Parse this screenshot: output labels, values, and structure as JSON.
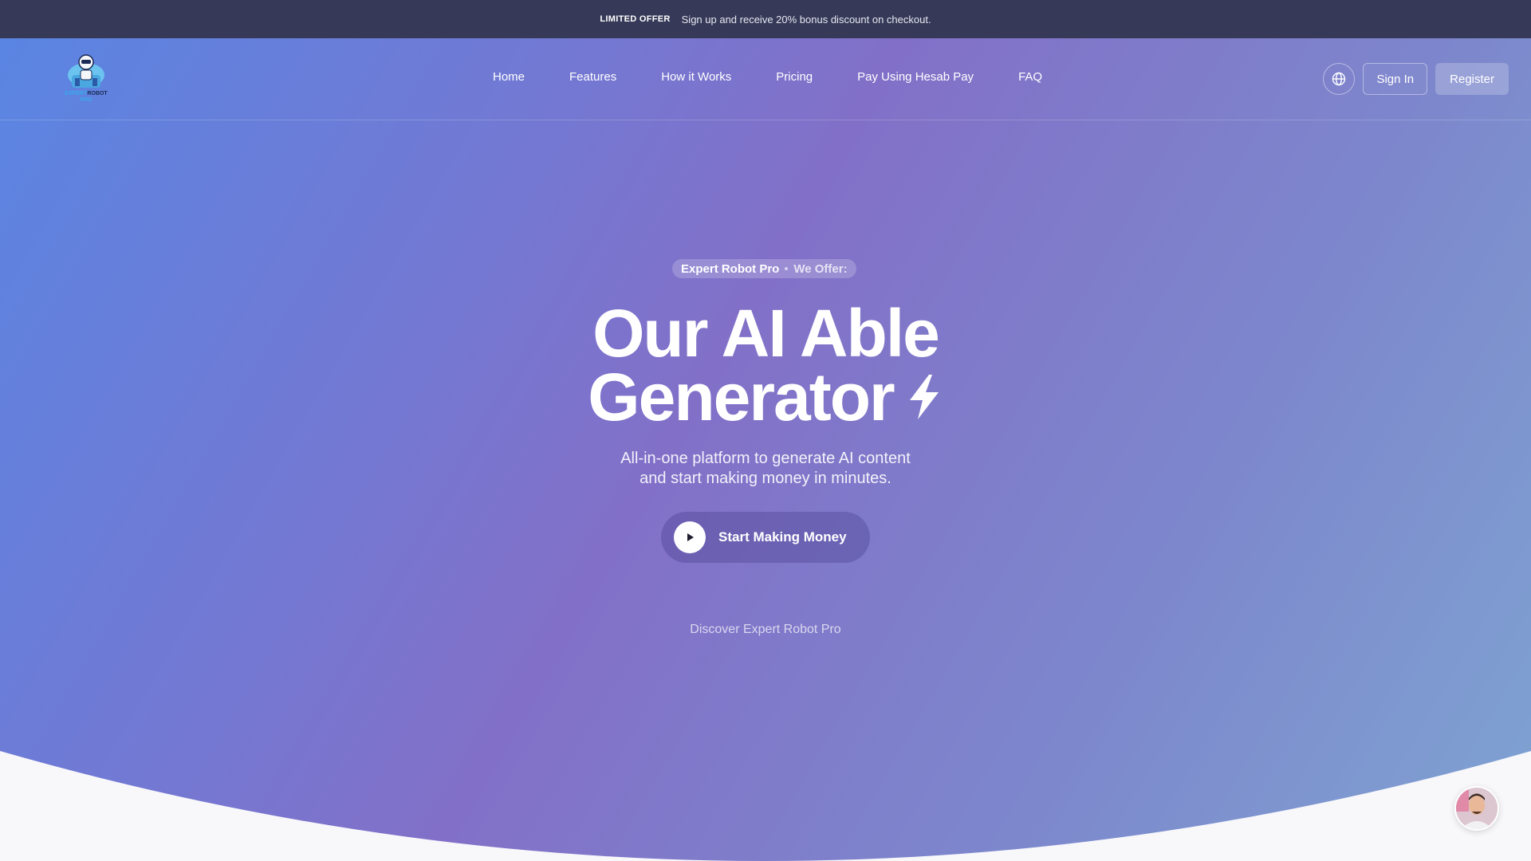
{
  "offer_bar": {
    "tag": "LIMITED OFFER",
    "message": "Sign up and receive 20% bonus discount on checkout."
  },
  "logo": {
    "line1_a": "EXPERT",
    "line1_b": "ROBOT",
    "line2": "PRO"
  },
  "nav": {
    "links": [
      "Home",
      "Features",
      "How it Works",
      "Pricing",
      "Pay Using Hesab Pay",
      "FAQ"
    ],
    "language_icon": "globe-icon",
    "sign_in": "Sign In",
    "register": "Register"
  },
  "hero": {
    "pill_brand": "Expert Robot Pro",
    "pill_offer": "We Offer:",
    "headline_line1": "Our AI Able",
    "headline_line2": "Generator",
    "headline_icon": "lightning-bolt-icon",
    "sub_line1": "All-in-one platform to generate AI content",
    "sub_line2": "and start making money in minutes.",
    "cta_label": "Start Making Money",
    "cta_icon": "play-icon",
    "discover": "Discover Expert Robot Pro"
  },
  "colors": {
    "topbar": "#363a58",
    "gradient_start": "#5a85e2",
    "gradient_mid": "#8270c8",
    "gradient_end": "#7ea3d2",
    "page_bg": "#f8f8fb"
  }
}
